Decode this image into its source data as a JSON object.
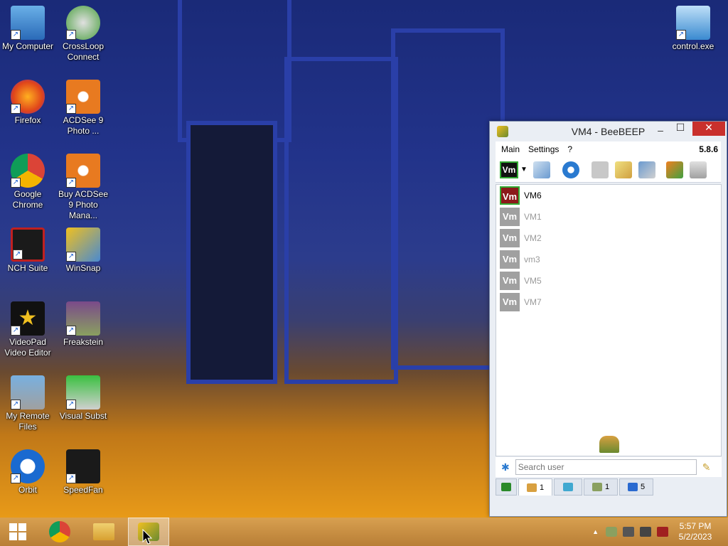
{
  "desktop": {
    "icons": [
      {
        "label": "My Computer",
        "icon": "computer-icon"
      },
      {
        "label": "CrossLoop Connect",
        "icon": "crossloop-icon"
      },
      {
        "label": "control.exe",
        "icon": "control-panel-icon"
      },
      {
        "label": "Firefox",
        "icon": "firefox-icon"
      },
      {
        "label": "ACDSee 9 Photo ...",
        "icon": "acdsee-icon"
      },
      {
        "label": "Google Chrome",
        "icon": "chrome-icon"
      },
      {
        "label": "Buy ACDSee 9 Photo Mana...",
        "icon": "acdsee-buy-icon"
      },
      {
        "label": "NCH Suite",
        "icon": "nch-icon"
      },
      {
        "label": "WinSnap",
        "icon": "winsnap-icon"
      },
      {
        "label": "VideoPad Video Editor",
        "icon": "videopad-icon"
      },
      {
        "label": "Freakstein",
        "icon": "freakstein-icon"
      },
      {
        "label": "My Remote Files",
        "icon": "remote-files-icon"
      },
      {
        "label": "Visual Subst",
        "icon": "visual-subst-icon"
      },
      {
        "label": "Orbit",
        "icon": "orbit-icon"
      },
      {
        "label": "SpeedFan",
        "icon": "speedfan-icon"
      }
    ]
  },
  "window": {
    "title": "VM4 - BeeBEEP",
    "minimize": "–",
    "maximize": "☐",
    "close": "✕",
    "menu": {
      "main": "Main",
      "settings": "Settings",
      "help": "?",
      "version": "5.8.6"
    },
    "status_badge": "Vm",
    "users": [
      {
        "badge": "Vm",
        "name": "VM6",
        "online": true
      },
      {
        "badge": "Vm",
        "name": "VM1",
        "online": false
      },
      {
        "badge": "Vm",
        "name": "VM2",
        "online": false
      },
      {
        "badge": "Vm",
        "name": "vm3",
        "online": false
      },
      {
        "badge": "Vm",
        "name": "VM5",
        "online": false
      },
      {
        "badge": "Vm",
        "name": "VM7",
        "online": false
      }
    ],
    "search": {
      "placeholder": "Search user",
      "value": ""
    },
    "tabs": [
      {
        "icon": "users-icon",
        "count": "1"
      },
      {
        "icon": "chat-icon",
        "count": ""
      },
      {
        "icon": "groups-icon",
        "count": "1"
      },
      {
        "icon": "files-icon",
        "count": "5"
      }
    ]
  },
  "taskbar": {
    "clock_time": "5:57 PM",
    "clock_date": "5/2/2023",
    "tray_arrow": "▲"
  },
  "colors": {
    "vm_online": "#8b1a1a",
    "vm_offline": "#a0a0a0",
    "online_text": "#000000",
    "offline_text": "#9a9a9a",
    "close_button": "#c9302c"
  }
}
